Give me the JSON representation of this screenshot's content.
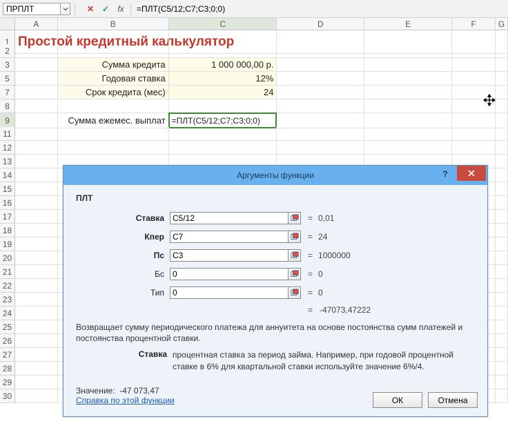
{
  "nameBox": "ПРПЛТ",
  "formulaBar": "=ПЛТ(C5/12;C7;C3;0;0)",
  "columns": [
    "A",
    "B",
    "C",
    "D",
    "E",
    "F",
    "G"
  ],
  "rows": [
    "1",
    "2",
    "3",
    "5",
    "7",
    "8",
    "9",
    "11",
    "12",
    "13",
    "14",
    "15",
    "16",
    "17",
    "18",
    "19",
    "20",
    "21",
    "22",
    "23",
    "24",
    "25",
    "26",
    "27",
    "28",
    "29",
    "30"
  ],
  "title": "Простой кредитный калькулятор",
  "dataCells": {
    "b3": "Сумма кредита",
    "c3": "1 000 000,00 р.",
    "b5": "Годовая ставка",
    "c5": "12%",
    "b7": "Срок кредита (мес)",
    "c7": "24",
    "b9": "Сумма ежемес. выплат",
    "c9_edit": "=ПЛТ(C5/12;C7;C3;0;0)"
  },
  "dialog": {
    "title": "Аргументы функции",
    "fnName": "ПЛТ",
    "args": [
      {
        "label": "Ставка",
        "value": "C5/12",
        "result": "0,01",
        "bold": true
      },
      {
        "label": "Кпер",
        "value": "C7",
        "result": "24",
        "bold": true
      },
      {
        "label": "Пс",
        "value": "C3",
        "result": "1000000",
        "bold": true
      },
      {
        "label": "Бс",
        "value": "0",
        "result": "0",
        "bold": false
      },
      {
        "label": "Тип",
        "value": "0",
        "result": "0",
        "bold": false
      }
    ],
    "returnLabel": "=",
    "returnValue": "-47073,47222",
    "description": "Возвращает сумму периодического платежа для аннуитета на основе постоянства сумм платежей и постоянства процентной ставки.",
    "argName": "Ставка",
    "argText": "процентная ставка за период займа. Например, при годовой процентной ставке в 6% для квартальной ставки используйте значение 6%/4.",
    "resultLabel": "Значение:",
    "resultValue": "-47 073,47",
    "helpLink": "Справка по этой функции",
    "ok": "ОК",
    "cancel": "Отмена",
    "helpBtn": "?"
  }
}
